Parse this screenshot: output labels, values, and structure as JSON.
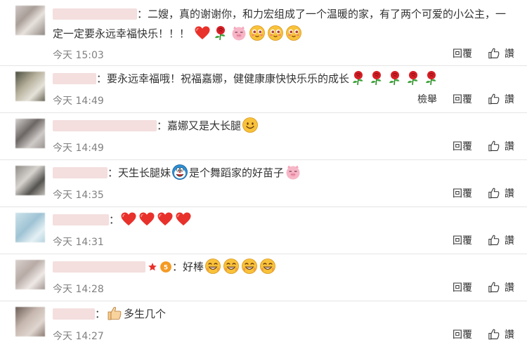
{
  "comments": [
    {
      "text_line1": "：二嫂，真的谢谢你，和力宏组成了一个温暖的家，有了两个可爱的小公主，一",
      "text_line2": "定一定要永远幸福快乐！！！",
      "emojis": [
        "heart-icon",
        "rose-icon",
        "pig-icon",
        "smiley-love-icon",
        "smiley-love-icon",
        "smiley-love-icon"
      ],
      "time": "今天 15:03",
      "reply": "回覆",
      "like": "讚"
    },
    {
      "text": "：要永远幸福哦！祝福嘉娜，健健康康快快乐乐的成长",
      "emojis": [
        "rose-icon",
        "rose-icon",
        "rose-icon",
        "rose-icon",
        "rose-icon"
      ],
      "time": "今天 14:49",
      "report": "檢舉",
      "reply": "回覆",
      "like": "讚"
    },
    {
      "text": "：嘉娜又是大长腿",
      "emojis": [
        "smile-icon"
      ],
      "time": "今天 14:49",
      "reply": "回覆",
      "like": "讚"
    },
    {
      "text_before": "：天生长腿妹",
      "text_after": "是个舞蹈家的好苗子",
      "time": "今天 14:35",
      "reply": "回覆",
      "like": "讚"
    },
    {
      "text": "：",
      "emojis": [
        "heart-icon",
        "heart-icon",
        "heart-icon",
        "heart-icon"
      ],
      "time": "今天 14:31",
      "reply": "回覆",
      "like": "讚"
    },
    {
      "text": "：好棒",
      "emojis": [
        "grin-icon",
        "grin-icon",
        "grin-icon",
        "grin-icon"
      ],
      "time": "今天 14:28",
      "reply": "回覆",
      "like": "讚"
    },
    {
      "text": "多生几个",
      "time": "今天 14:27",
      "reply": "回覆",
      "like": "讚"
    }
  ]
}
